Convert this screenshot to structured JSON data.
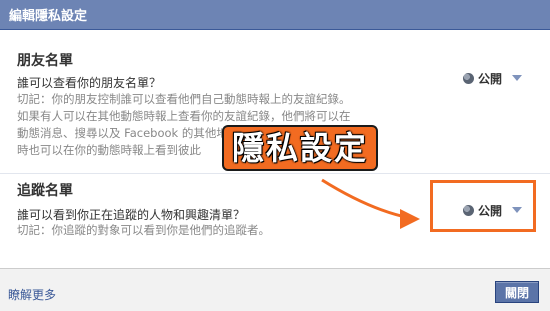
{
  "dialog": {
    "title": "編輯隱私設定"
  },
  "friends_list": {
    "heading": "朋友名單",
    "question": "誰可以查看你的朋友名單？",
    "note_lines": [
      "切記：你的朋友控制誰可以查看他們自己動態時報上的友誼紀錄。",
      "如果有人可以在其他動態時報上查看你的友誼紀錄，他們將可以在",
      "動態消息、搜尋以及 Facebook 的其他地方看到這個紀錄。他們同",
      "時也可以在你的動態時報上看到彼此"
    ],
    "audience": "公開"
  },
  "followers": {
    "heading": "追蹤名單",
    "question": "誰可以看到你正在追蹤的人物和興趣清單？",
    "note": "切記：你追蹤的對象可以看到你是他們的追蹤者。",
    "audience": "公開"
  },
  "annotation": {
    "text": "隱私設定",
    "color": "#f26b21"
  },
  "footer": {
    "learn_more": "瞭解更多",
    "close_label": "關閉"
  },
  "colors": {
    "titlebar": "#6d84b4",
    "link": "#3b5998",
    "button": "#5b74a8"
  }
}
